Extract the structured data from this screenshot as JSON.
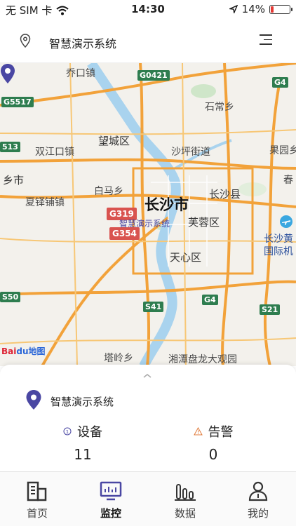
{
  "status_bar": {
    "carrier": "无 SIM 卡",
    "time": "14:30",
    "battery_text": "14%",
    "battery_level": 0.14
  },
  "header": {
    "title": "智慧演示系统"
  },
  "map": {
    "city_label": "长沙市",
    "pin_caption": "智慧演示系统",
    "watermark_a": "Bai",
    "watermark_b": "du",
    "watermark_c": "地图",
    "labels": [
      "乔口镇",
      "石常乡",
      "望城区",
      "双江口镇",
      "沙坪街道",
      "果园乡",
      "乡市",
      "白马乡",
      "长沙县",
      "春",
      "夏铎铺镇",
      "芙蓉区",
      "长沙黄",
      "国际机",
      "天心区",
      "塔岭乡",
      "湘潭盘龙大观园"
    ],
    "road_shields": [
      "G0421",
      "G4",
      "G5517",
      "513",
      "G319",
      "G354",
      "S50",
      "S41",
      "G4",
      "S21"
    ]
  },
  "summary": {
    "title": "智慧演示系统",
    "devices_label": "设备",
    "devices_count": "11",
    "alarms_label": "告警",
    "alarms_count": "0"
  },
  "tabs": [
    {
      "label": "首页",
      "icon": "building-icon"
    },
    {
      "label": "监控",
      "icon": "monitor-icon",
      "active": true
    },
    {
      "label": "数据",
      "icon": "bar-chart-icon"
    },
    {
      "label": "我的",
      "icon": "user-icon"
    }
  ],
  "colors": {
    "accent": "#4a47a3",
    "road": "#f2a23a",
    "river": "#a9d3ee",
    "battery_low": "#e53935"
  }
}
